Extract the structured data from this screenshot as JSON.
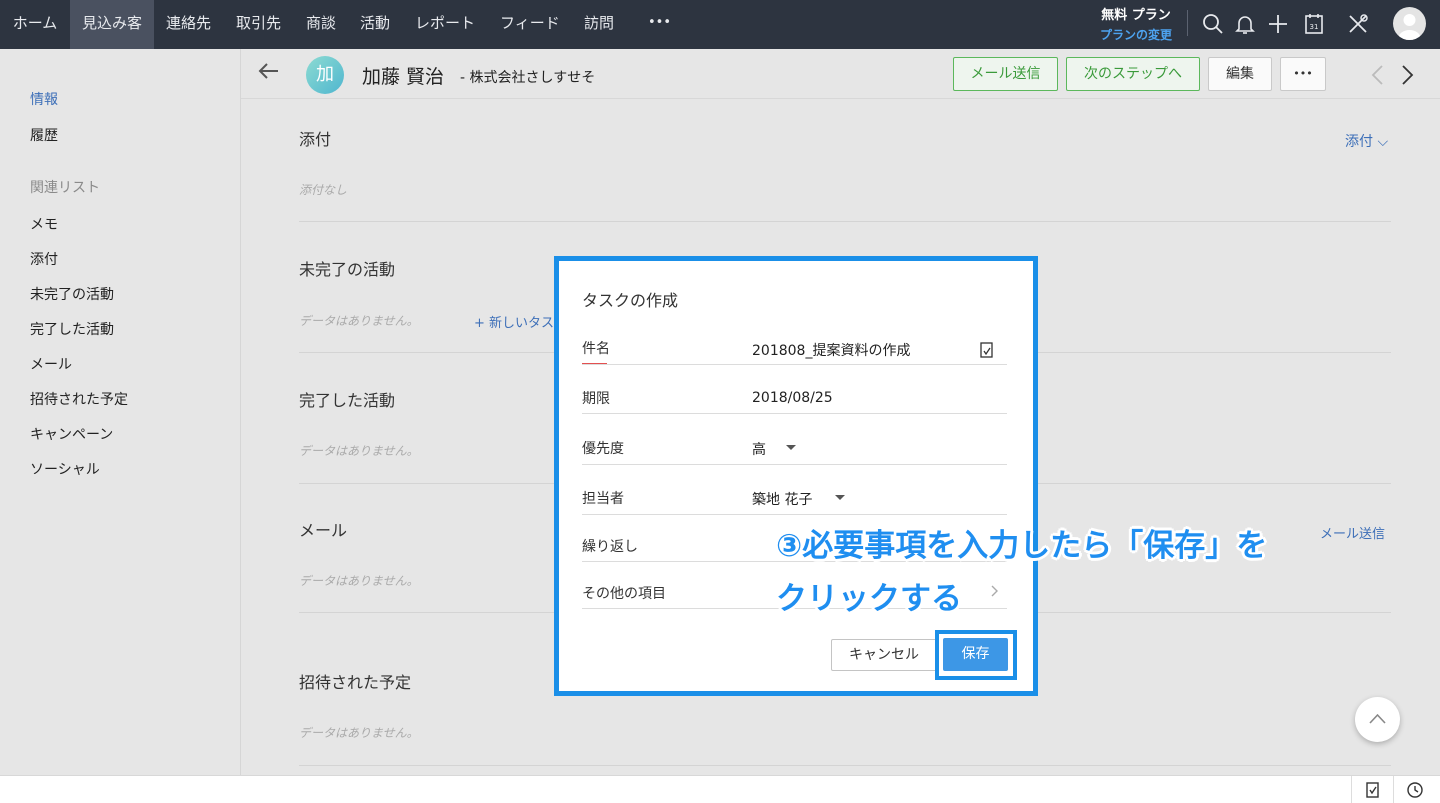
{
  "nav": {
    "items": [
      "ホーム",
      "見込み客",
      "連絡先",
      "取引先",
      "商談",
      "活動",
      "レポート",
      "フィード",
      "訪問"
    ],
    "more": "•••",
    "plan_label": "無料 プラン",
    "plan_change": "プランの変更"
  },
  "sidebar": {
    "top": [
      "情報",
      "履歴"
    ],
    "related_heading": "関連リスト",
    "related": [
      "メモ",
      "添付",
      "未完了の活動",
      "完了した活動",
      "メール",
      "招待された予定",
      "キャンペーン",
      "ソーシャル"
    ]
  },
  "record": {
    "avatar_initial": "加",
    "name": "加藤 賢治",
    "company": "- 株式会社さしすせそ",
    "send_mail": "メール送信",
    "next_step": "次のステップへ",
    "edit": "編集",
    "more": "•••"
  },
  "sections": {
    "attachments": {
      "title": "添付",
      "empty": "添付なし",
      "action": "添付 ⌵"
    },
    "open_activities": {
      "title": "未完了の活動",
      "empty": "データはありません。",
      "action": "+ 新しいタス"
    },
    "closed_activities": {
      "title": "完了した活動",
      "empty": "データはありません。"
    },
    "mail": {
      "title": "メール",
      "empty": "データはありません。",
      "action": "メール送信"
    },
    "invited": {
      "title": "招待された予定",
      "empty": "データはありません。"
    }
  },
  "dialog": {
    "title": "タスクの作成",
    "fields": [
      {
        "label": "件名",
        "value": "201808_提案資料の作成"
      },
      {
        "label": "期限",
        "value": "2018/08/25"
      },
      {
        "label": "優先度",
        "value": "高"
      },
      {
        "label": "担当者",
        "value": "築地 花子"
      },
      {
        "label": "繰り返し",
        "value": ""
      },
      {
        "label": "その他の項目",
        "value": ""
      }
    ],
    "cancel": "キャンセル",
    "save": "保存"
  },
  "annotation": {
    "line1": "③必要事項を入力したら「保存」を",
    "line2": "クリックする"
  },
  "colors": {
    "nav_bg": "#2d3440",
    "accent_blue": "#1a8fe8",
    "link_blue": "#3d6fb8",
    "green": "#5cb85c"
  }
}
